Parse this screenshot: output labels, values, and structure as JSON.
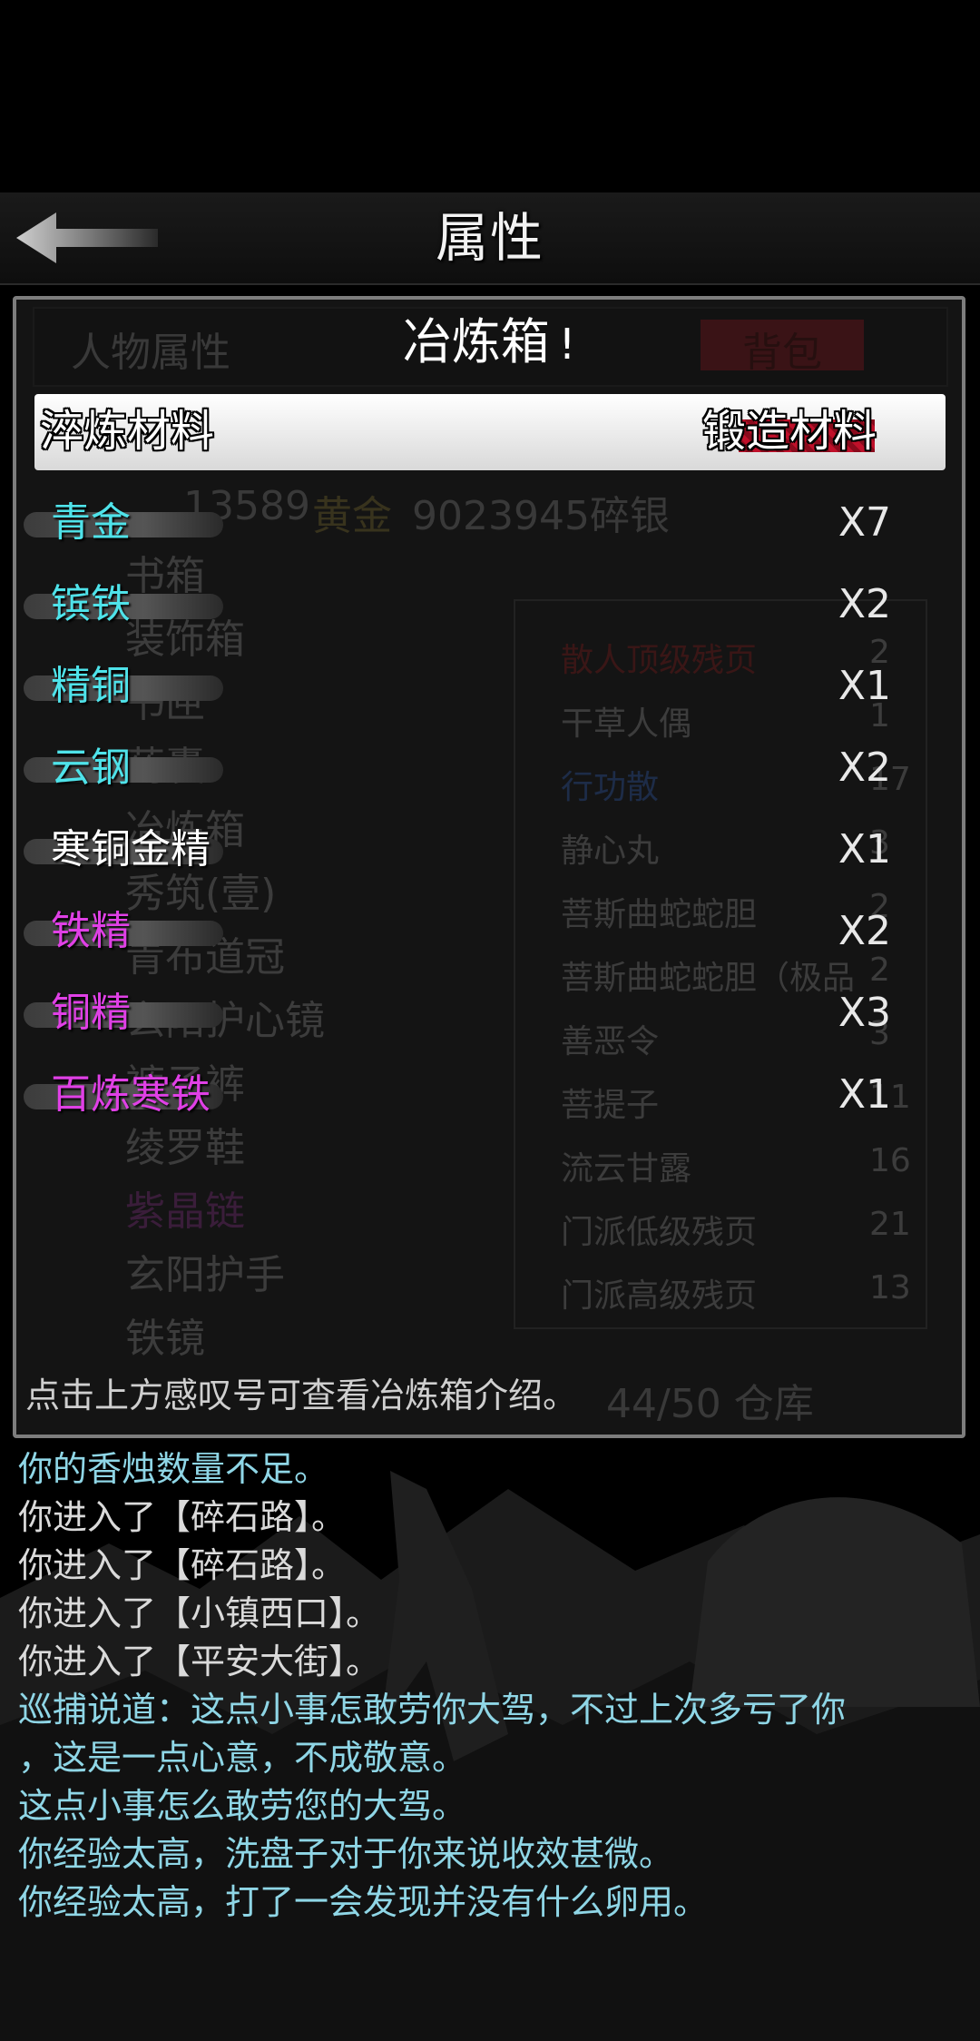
{
  "header": {
    "title": "属性"
  },
  "background_panel": {
    "tab_left": "人物属性",
    "tab_right": "背包",
    "currency": {
      "label1": "黄金",
      "value1": "13589",
      "label2": "黄金",
      "value2": "9023945碎银"
    },
    "left_list": [
      "书箱",
      "装饰箱",
      "书匣",
      "药囊",
      "冶炼箱",
      "秀筑(壹)",
      "青布道冠",
      "玄阳护心镜",
      "裤子裤",
      "绫罗鞋",
      "紫晶链",
      "玄阳护手",
      "铁镜"
    ],
    "right_list": [
      {
        "name": "散人顶级残页",
        "count": "2"
      },
      {
        "name": "干草人偶",
        "count": "1"
      },
      {
        "name": "行功散",
        "count": "17"
      },
      {
        "name": "静心丸",
        "count": "3"
      },
      {
        "name": "菩斯曲蛇蛇胆",
        "count": "2"
      },
      {
        "name": "菩斯曲蛇蛇胆（极品",
        "count": "2"
      },
      {
        "name": "善恶令",
        "count": "3"
      },
      {
        "name": "菩提子",
        "count": "11"
      },
      {
        "name": "流云甘露",
        "count": "16"
      },
      {
        "name": "门派低级残页",
        "count": "21"
      },
      {
        "name": "门派高级残页",
        "count": "13"
      }
    ],
    "storage": "44/50 仓库"
  },
  "dialog": {
    "title": "冶炼箱",
    "info_mark": "!",
    "category_left": "淬炼材料",
    "category_right": "锻造材料",
    "items": [
      {
        "name": "青金",
        "qty": "X7",
        "color": "#4fe3ea"
      },
      {
        "name": "镔铁",
        "qty": "X2",
        "color": "#4fe3ea"
      },
      {
        "name": "精铜",
        "qty": "X1",
        "color": "#4fe3ea"
      },
      {
        "name": "云钢",
        "qty": "X2",
        "color": "#4fe3ea"
      },
      {
        "name": "寒铜金精",
        "qty": "X1",
        "color": "#ffffff"
      },
      {
        "name": "铁精",
        "qty": "X2",
        "color": "#e040e6"
      },
      {
        "name": "铜精",
        "qty": "X3",
        "color": "#e040e6"
      },
      {
        "name": "百炼寒铁",
        "qty": "X1",
        "color": "#e040e6"
      }
    ],
    "hint": "点击上方感叹号可查看冶炼箱介绍。"
  },
  "log": [
    {
      "text": "你的香烛数量不足。",
      "color": "#8fd6e6"
    },
    {
      "text": "你进入了【碎石路】。",
      "color": "#dadada"
    },
    {
      "text": "你进入了【碎石路】。",
      "color": "#dadada"
    },
    {
      "text": "你进入了【小镇西口】。",
      "color": "#dadada"
    },
    {
      "text": "你进入了【平安大街】。",
      "color": "#dadada"
    },
    {
      "text": "巡捕说道：这点小事怎敢劳你大驾，不过上次多亏了你",
      "color": "#8fd6e6"
    },
    {
      "text": "，这是一点心意，不成敬意。",
      "color": "#8fd6e6"
    },
    {
      "text": "这点小事怎么敢劳您的大驾。",
      "color": "#8fd6e6"
    },
    {
      "text": "你经验太高，洗盘子对于你来说收效甚微。",
      "color": "#8fd6e6"
    },
    {
      "text": "你经验太高，打了一会发现并没有什么卵用。",
      "color": "#8fd6e6"
    }
  ]
}
